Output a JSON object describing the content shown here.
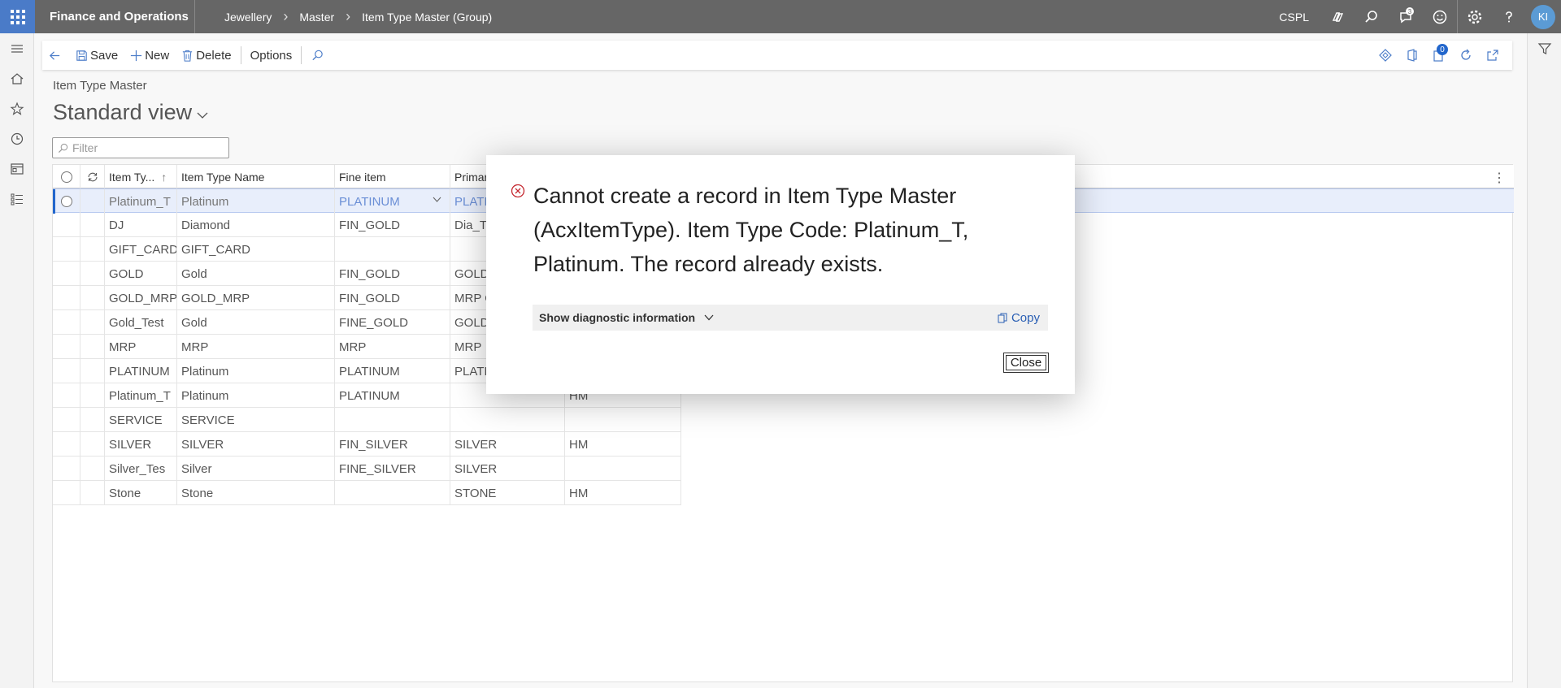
{
  "topbar": {
    "app_title": "Finance and Operations",
    "breadcrumb": [
      "Jewellery",
      "Master",
      "Item Type Master (Group)"
    ],
    "company": "CSPL",
    "notification_count": "3",
    "avatar_initials": "KI"
  },
  "actionpane": {
    "save": "Save",
    "new": "New",
    "delete": "Delete",
    "options": "Options",
    "attachments_count": "0"
  },
  "page": {
    "caption": "Item Type Master",
    "view_title": "Standard view",
    "filter_placeholder": "Filter"
  },
  "grid": {
    "columns": [
      "Item Ty...",
      "Item Type Name",
      "Fine item",
      "Primar"
    ],
    "rows": [
      {
        "code": "Platinum_T",
        "name": "Platinum",
        "fine": "PLATINUM",
        "primary": "PLATI",
        "extra": ""
      },
      {
        "code": "DJ",
        "name": "Diamond",
        "fine": "FIN_GOLD",
        "primary": "Dia_Te",
        "extra": ""
      },
      {
        "code": "GIFT_CARD",
        "name": "GIFT_CARD",
        "fine": "",
        "primary": "",
        "extra": ""
      },
      {
        "code": "GOLD",
        "name": "Gold",
        "fine": "FIN_GOLD",
        "primary": "GOLD",
        "extra": ""
      },
      {
        "code": "GOLD_MRP",
        "name": "GOLD_MRP",
        "fine": "FIN_GOLD",
        "primary": "MRP G",
        "extra": ""
      },
      {
        "code": "Gold_Test",
        "name": "Gold",
        "fine": "FINE_GOLD",
        "primary": "GOLD",
        "extra": ""
      },
      {
        "code": "MRP",
        "name": "MRP",
        "fine": "MRP",
        "primary": "MRP",
        "extra": ""
      },
      {
        "code": "PLATINUM",
        "name": "Platinum",
        "fine": "PLATINUM",
        "primary": "PLATI",
        "extra": ""
      },
      {
        "code": "Platinum_T",
        "name": "Platinum",
        "fine": "PLATINUM",
        "primary": "",
        "extra": "HM"
      },
      {
        "code": "SERVICE",
        "name": "SERVICE",
        "fine": "",
        "primary": "",
        "extra": ""
      },
      {
        "code": "SILVER",
        "name": "SILVER",
        "fine": "FIN_SILVER",
        "primary": "SILVER",
        "extra": "HM"
      },
      {
        "code": "Silver_Tes",
        "name": "Silver",
        "fine": "FINE_SILVER",
        "primary": "SILVER",
        "extra": ""
      },
      {
        "code": "Stone",
        "name": "Stone",
        "fine": "",
        "primary": "STONE",
        "extra": "HM"
      }
    ]
  },
  "dialog": {
    "message": "Cannot create a record in Item Type Master (AcxItemType). Item Type Code: Platinum_T, Platinum. The record already exists.",
    "diagnostic_label": "Show diagnostic information",
    "copy_label": "Copy",
    "close_label": "Close"
  },
  "colors": {
    "topbar": "#666666",
    "waffle": "#4a7bc8",
    "accent": "#2266cc",
    "error": "#c4262e"
  }
}
